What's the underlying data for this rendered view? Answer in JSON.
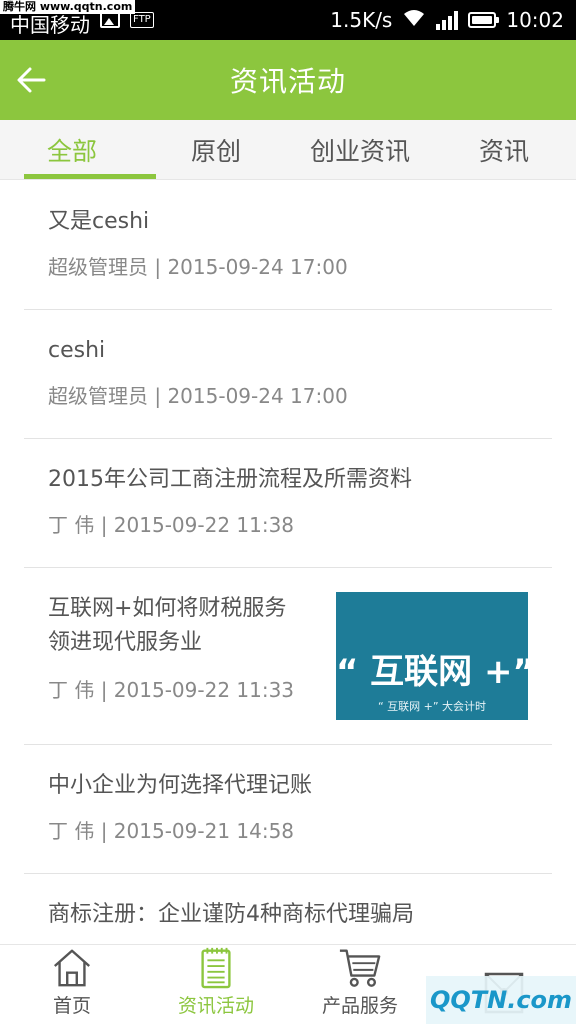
{
  "watermark_top": "腾牛网 www.qqtn.com",
  "status_bar": {
    "carrier": "中国移动",
    "speed": "1.5K/s",
    "time": "10:02",
    "ftp_label": "FTP"
  },
  "header": {
    "title": "资讯活动",
    "back_icon": "arrow-left-icon"
  },
  "tabs": [
    {
      "label": "全部",
      "active": true
    },
    {
      "label": "原创",
      "active": false
    },
    {
      "label": "创业资讯",
      "active": false
    },
    {
      "label": "资讯",
      "active": false
    }
  ],
  "news": [
    {
      "title": "又是ceshi",
      "meta": "超级管理员 | 2015-09-24 17:00"
    },
    {
      "title": "ceshi",
      "meta": "超级管理员 | 2015-09-24 17:00"
    },
    {
      "title": "2015年公司工商注册流程及所需资料",
      "meta": "丁  伟 | 2015-09-22 11:38"
    },
    {
      "title_line1": "互联网+如何将财税服务",
      "title_line2": "领进现代服务业",
      "meta": "丁  伟 | 2015-09-22 11:33",
      "thumb_text": "“ 互联网 +”",
      "thumb_sub": "“ 互联网 +” 大会计时"
    },
    {
      "title": "中小企业为何选择代理记账",
      "meta": "丁  伟 | 2015-09-21 14:58"
    },
    {
      "title": "商标注册：企业谨防4种商标代理骗局"
    }
  ],
  "bottom_nav": [
    {
      "label": "首页",
      "icon": "home-icon",
      "active": false
    },
    {
      "label": "资讯活动",
      "icon": "notepad-icon",
      "active": true
    },
    {
      "label": "产品服务",
      "icon": "cart-icon",
      "active": false
    },
    {
      "label": "",
      "icon": "envelope-icon",
      "active": false
    }
  ],
  "watermark_bottom": "QQTN.com",
  "colors": {
    "accent": "#8cc63e",
    "status_bar": "#000000",
    "thumb_bg": "#1e7c98"
  }
}
